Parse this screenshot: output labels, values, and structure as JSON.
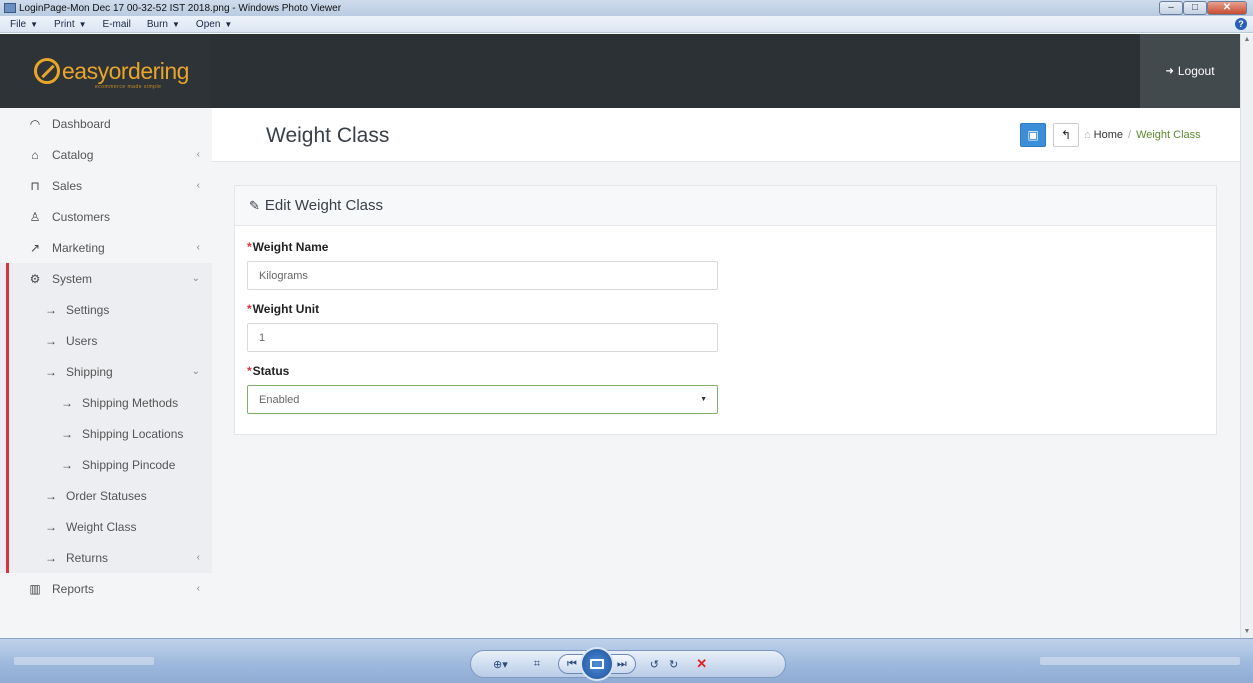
{
  "window": {
    "title": "LoginPage-Mon Dec 17 00-32-52 IST 2018.png - Windows Photo Viewer",
    "menu": [
      {
        "label": "File"
      },
      {
        "label": "Print"
      },
      {
        "label": "E-mail"
      },
      {
        "label": "Burn"
      },
      {
        "label": "Open"
      }
    ],
    "help_glyph": "?"
  },
  "brand": {
    "name": "easyordering",
    "tagline": "ecommerce made simple"
  },
  "topnav": {
    "logout_label": "Logout"
  },
  "sidebar": {
    "items": [
      {
        "label": "Dashboard"
      },
      {
        "label": "Catalog"
      },
      {
        "label": "Sales"
      },
      {
        "label": "Customers"
      },
      {
        "label": "Marketing"
      },
      {
        "label": "System"
      },
      {
        "label": "Settings"
      },
      {
        "label": "Users"
      },
      {
        "label": "Shipping"
      },
      {
        "label": "Shipping Methods"
      },
      {
        "label": "Shipping Locations"
      },
      {
        "label": "Shipping Pincode"
      },
      {
        "label": "Order Statuses"
      },
      {
        "label": "Weight Class"
      },
      {
        "label": "Returns"
      },
      {
        "label": "Reports"
      }
    ]
  },
  "page": {
    "title": "Weight Class",
    "breadcrumb": {
      "home": "Home",
      "separator": "/",
      "current": "Weight Class"
    }
  },
  "form": {
    "heading": "Edit Weight Class",
    "required_mark": "*",
    "fields": {
      "weight_name": {
        "label": "Weight Name",
        "value": "Kilograms"
      },
      "weight_unit": {
        "label": "Weight Unit",
        "value": "1"
      },
      "status": {
        "label": "Status",
        "value": "Enabled"
      }
    }
  },
  "colors": {
    "topnav_bg": "#2b3134",
    "brand_accent": "#e8a52b",
    "active_indicator": "#d8333f",
    "save_button": "#3b8fd8",
    "breadcrumb_current": "#5b8a2f"
  }
}
